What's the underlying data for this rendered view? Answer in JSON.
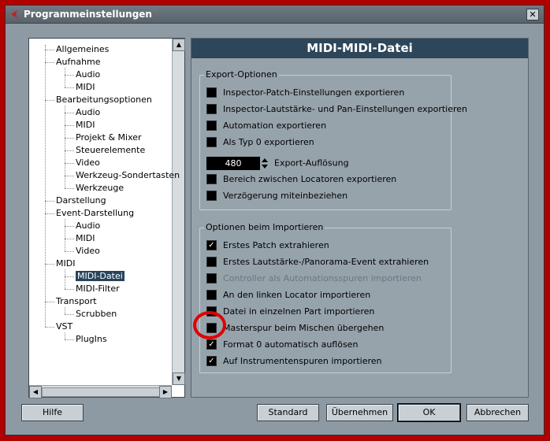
{
  "window": {
    "title": "Programmeinstellungen",
    "close_glyph": "✕"
  },
  "tree": [
    {
      "label": "Allgemeines",
      "level": 0
    },
    {
      "label": "Aufnahme",
      "level": 0
    },
    {
      "label": "Audio",
      "level": 1
    },
    {
      "label": "MIDI",
      "level": 1
    },
    {
      "label": "Bearbeitungsoptionen",
      "level": 0
    },
    {
      "label": "Audio",
      "level": 1
    },
    {
      "label": "MIDI",
      "level": 1
    },
    {
      "label": "Projekt & Mixer",
      "level": 1
    },
    {
      "label": "Steuerelemente",
      "level": 1
    },
    {
      "label": "Video",
      "level": 1
    },
    {
      "label": "Werkzeug-Sondertasten",
      "level": 1
    },
    {
      "label": "Werkzeuge",
      "level": 1
    },
    {
      "label": "Darstellung",
      "level": 0
    },
    {
      "label": "Event-Darstellung",
      "level": 0
    },
    {
      "label": "Audio",
      "level": 1
    },
    {
      "label": "MIDI",
      "level": 1
    },
    {
      "label": "Video",
      "level": 1
    },
    {
      "label": "MIDI",
      "level": 0
    },
    {
      "label": "MIDI-Datei",
      "level": 1,
      "selected": true
    },
    {
      "label": "MIDI-Filter",
      "level": 1
    },
    {
      "label": "Transport",
      "level": 0
    },
    {
      "label": "Scrubben",
      "level": 1
    },
    {
      "label": "VST",
      "level": 0
    },
    {
      "label": "PlugIns",
      "level": 1
    }
  ],
  "panel": {
    "header": "MIDI-MIDI-Datei",
    "export": {
      "title": "Export-Optionen",
      "options": [
        {
          "label": "Inspector-Patch-Einstellungen exportieren",
          "checked": false
        },
        {
          "label": "Inspector-Lautstärke- und Pan-Einstellungen exportieren",
          "checked": false
        },
        {
          "label": "Automation exportieren",
          "checked": false
        },
        {
          "label": "Als Typ 0 exportieren",
          "checked": false
        }
      ],
      "resolution_value": "480",
      "resolution_label": "Export-Auflösung",
      "options2": [
        {
          "label": "Bereich zwischen Locatoren exportieren",
          "checked": false
        },
        {
          "label": "Verzögerung miteinbeziehen",
          "checked": false
        }
      ]
    },
    "import": {
      "title": "Optionen beim Importieren",
      "options": [
        {
          "label": "Erstes Patch extrahieren",
          "checked": true
        },
        {
          "label": "Erstes Lautstärke-/Panorama-Event extrahieren",
          "checked": false
        },
        {
          "label": "Controller als Automationsspuren importieren",
          "checked": false,
          "disabled": true
        },
        {
          "label": "An den linken Locator importieren",
          "checked": false
        },
        {
          "label": "Datei in einzelnen Part importieren",
          "checked": false
        },
        {
          "label": "Masterspur beim Mischen übergehen",
          "checked": false
        },
        {
          "label": "Format 0 automatisch auflösen",
          "checked": true
        },
        {
          "label": "Auf Instrumentenspuren importieren",
          "checked": true
        }
      ]
    }
  },
  "buttons": {
    "help": "Hilfe",
    "standard": "Standard",
    "apply": "Übernehmen",
    "ok": "OK",
    "cancel": "Abbrechen"
  },
  "check_glyph": "✓"
}
